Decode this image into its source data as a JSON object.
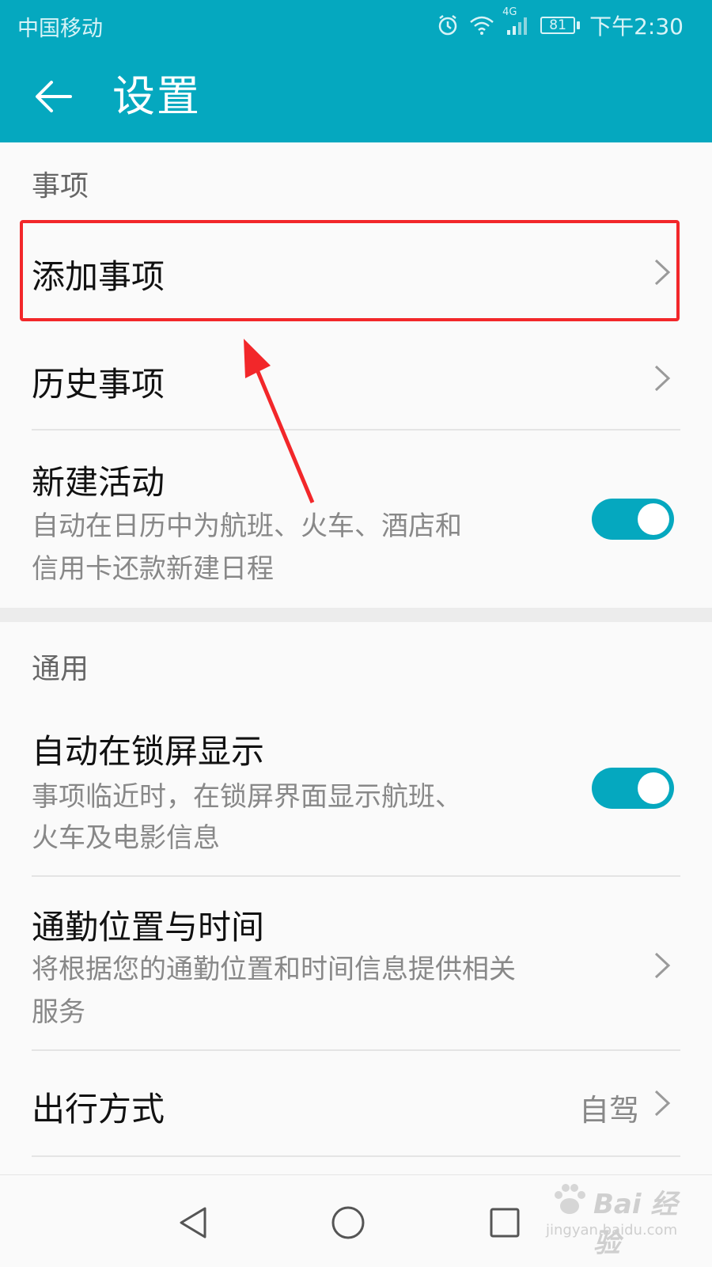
{
  "status_bar": {
    "carrier": "中国移动",
    "network": "4G",
    "battery": "81",
    "time": "下午2:30"
  },
  "app_bar": {
    "title": "设置",
    "back_icon": "back-arrow-icon"
  },
  "sections": [
    {
      "header": "事项",
      "items": [
        {
          "title": "添加事项",
          "control": "chevron"
        },
        {
          "title": "历史事项",
          "control": "chevron"
        },
        {
          "title": "新建活动",
          "subtitle_line1": "自动在日历中为航班、火车、酒店和",
          "subtitle_line2": "信用卡还款新建日程",
          "control": "toggle",
          "toggle_on": true
        }
      ]
    },
    {
      "header": "通用",
      "items": [
        {
          "title": "自动在锁屏显示",
          "subtitle_line1": "事项临近时，在锁屏界面显示航班、",
          "subtitle_line2": "火车及电影信息",
          "control": "toggle",
          "toggle_on": true
        },
        {
          "title": "通勤位置与时间",
          "subtitle_line1": "将根据您的通勤位置和时间信息提供相关",
          "subtitle_line2": "服务",
          "control": "chevron"
        },
        {
          "title": "出行方式",
          "value": "自驾",
          "control": "chevron"
        }
      ]
    }
  ],
  "nav_bar": {
    "icons": [
      "back-triangle-icon",
      "home-circle-icon",
      "recents-square-icon"
    ]
  },
  "watermark": {
    "text": "Bai 经验",
    "sub": "jingyan.baidu.com"
  },
  "colors": {
    "accent": "#05a8bf",
    "highlight": "#f2272a",
    "background": "#fafafa"
  }
}
